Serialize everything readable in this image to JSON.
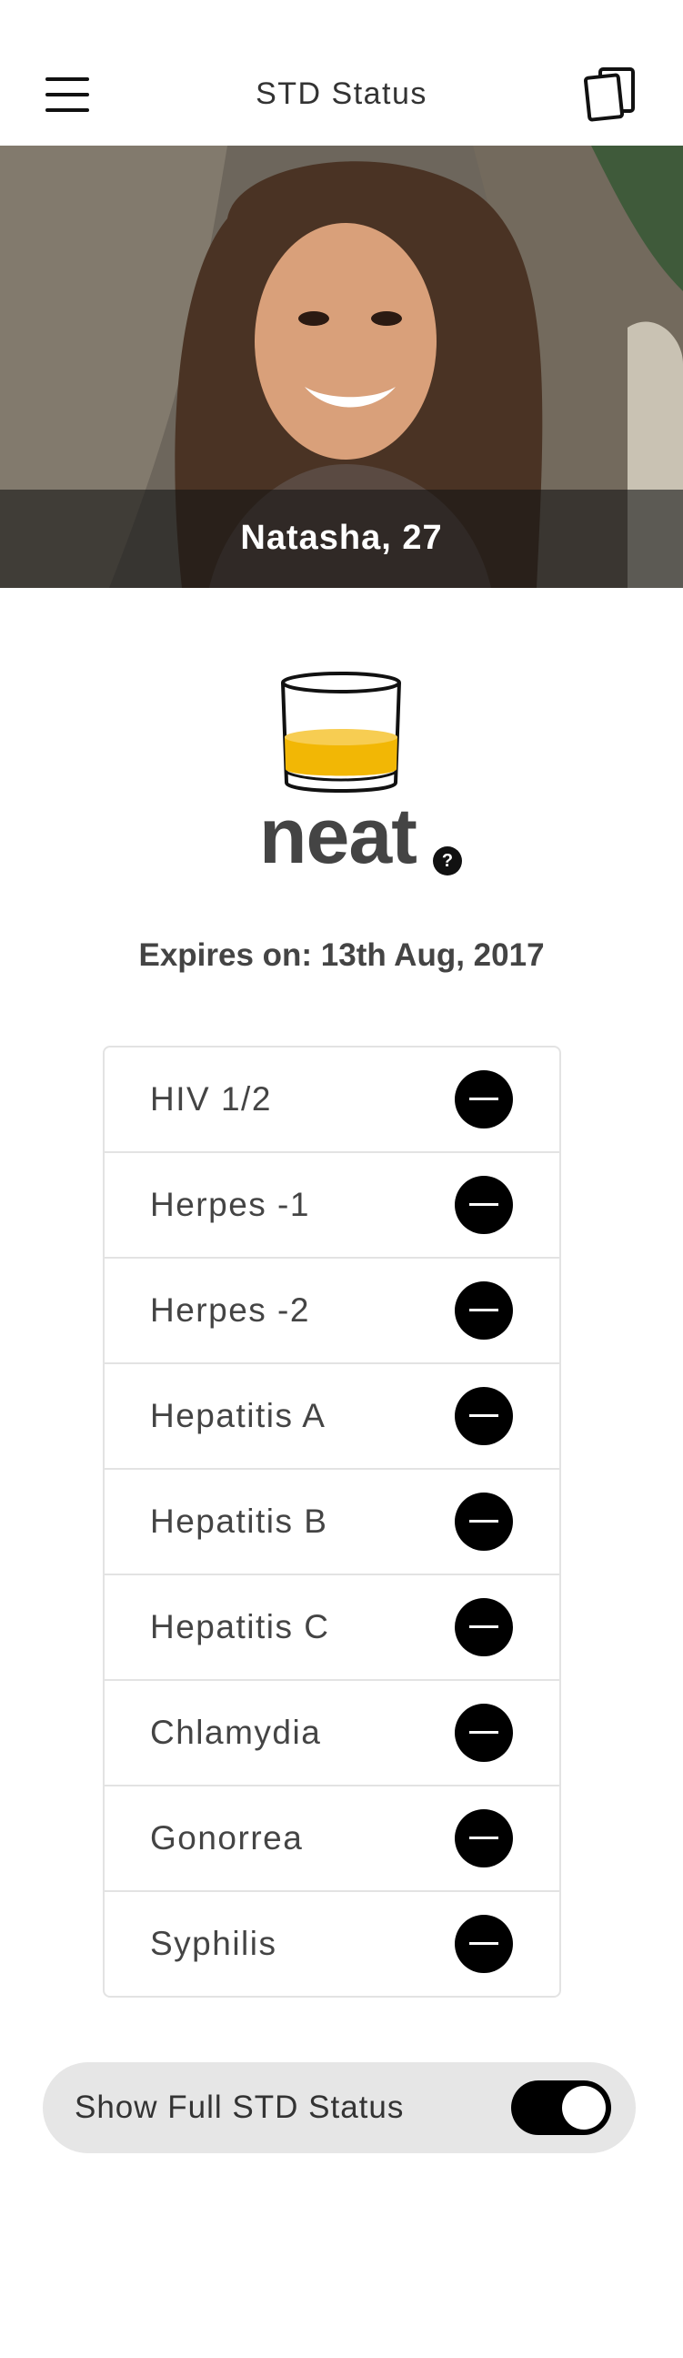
{
  "header": {
    "title": "STD Status",
    "menu_icon": "hamburger-menu-icon",
    "cards_icon": "cards-icon"
  },
  "profile": {
    "name_age": "Natasha, 27"
  },
  "status": {
    "word": "neat",
    "help_glyph": "?",
    "glass_fill_color": "#f2b705",
    "expires": "Expires on: 13th Aug, 2017"
  },
  "std_tests": [
    {
      "label": "HIV 1/2",
      "indicator": "minus-circle-icon"
    },
    {
      "label": "Herpes -1",
      "indicator": "minus-circle-icon"
    },
    {
      "label": "Herpes -2",
      "indicator": "minus-circle-icon"
    },
    {
      "label": "Hepatitis A",
      "indicator": "minus-circle-icon"
    },
    {
      "label": "Hepatitis B",
      "indicator": "minus-circle-icon"
    },
    {
      "label": "Hepatitis C",
      "indicator": "minus-circle-icon"
    },
    {
      "label": "Chlamydia",
      "indicator": "minus-circle-icon"
    },
    {
      "label": "Gonorrea",
      "indicator": "minus-circle-icon"
    },
    {
      "label": "Syphilis",
      "indicator": "minus-circle-icon"
    }
  ],
  "full_status_toggle": {
    "label": "Show Full STD Status",
    "on": true
  }
}
